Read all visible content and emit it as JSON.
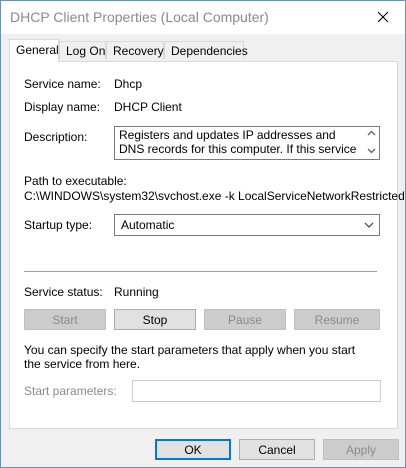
{
  "window": {
    "title": "DHCP Client Properties (Local Computer)"
  },
  "tabs": [
    {
      "label": "General",
      "active": true
    },
    {
      "label": "Log On"
    },
    {
      "label": "Recovery"
    },
    {
      "label": "Dependencies"
    }
  ],
  "general": {
    "service_name_label": "Service name:",
    "service_name_value": "Dhcp",
    "display_name_label": "Display name:",
    "display_name_value": "DHCP Client",
    "description_label": "Description:",
    "description_value": "Registers and updates IP addresses and DNS records for this computer. If this service is stopped,",
    "path_label": "Path to executable:",
    "path_value": "C:\\WINDOWS\\system32\\svchost.exe -k LocalServiceNetworkRestricted",
    "startup_type_label": "Startup type:",
    "startup_type_value": "Automatic",
    "service_status_label": "Service status:",
    "service_status_value": "Running",
    "buttons": {
      "start": "Start",
      "stop": "Stop",
      "pause": "Pause",
      "resume": "Resume"
    },
    "info_text": "You can specify the start parameters that apply when you start the service from here.",
    "start_params_label": "Start parameters:",
    "start_params_value": ""
  },
  "footer": {
    "ok": "OK",
    "cancel": "Cancel",
    "apply": "Apply"
  },
  "colors": {
    "accent": "#0078d7",
    "disabled_text": "#8a8a8a",
    "window_bg": "#f0f0f0"
  }
}
